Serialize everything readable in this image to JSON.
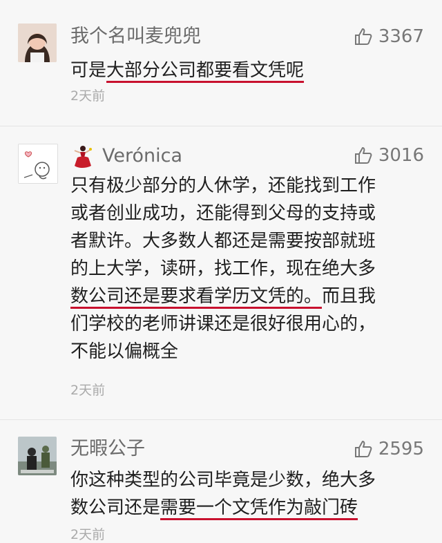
{
  "comments": [
    {
      "author": "我个名叫麦兜兜",
      "likes": "3367",
      "lines": [
        {
          "pre": "可是",
          "ul": "大部分公司都要看文凭呢",
          "post": ""
        }
      ],
      "time": "2天前"
    },
    {
      "author": "Verónica",
      "likes": "3016",
      "lines": [
        {
          "pre": "只有极少部分的人休学，还能找到工作",
          "ul": "",
          "post": ""
        },
        {
          "pre": "或者创业成功，还能得到父母的支持或",
          "ul": "",
          "post": ""
        },
        {
          "pre": "者默许。大多数人都还是需要按部就班",
          "ul": "",
          "post": ""
        },
        {
          "pre": "的上大学，读研，找工作，现在绝大多",
          "ul": "",
          "post": ""
        },
        {
          "pre": "",
          "ul": "数公司还是要求看学历文凭的。",
          "post": "而且我"
        },
        {
          "pre": "们学校的老师讲课还是很好很用心的，",
          "ul": "",
          "post": ""
        },
        {
          "pre": "不能以偏概全",
          "ul": "",
          "post": ""
        }
      ],
      "time": "2天前"
    },
    {
      "author": "无暇公子",
      "likes": "2595",
      "lines": [
        {
          "pre": "你这种类型的公司毕竟是少数，绝大多",
          "ul": "",
          "post": ""
        },
        {
          "pre": "数公司还是",
          "ul": "需要一个文凭作为敲门砖",
          "post": ""
        }
      ],
      "time": "2天前"
    }
  ],
  "icons": {
    "like": "thumbs-up-icon",
    "accent_underline": "#c8102e"
  }
}
